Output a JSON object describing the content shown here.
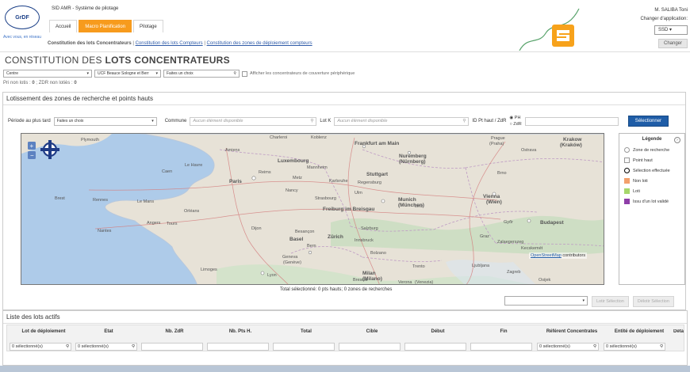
{
  "header": {
    "logo_text": "GrDF",
    "logo_tagline": "Avec vous, en réseau",
    "app_title": "SID AMR - Système de pilotage",
    "nav_tabs": [
      {
        "label": "Accueil",
        "active": false
      },
      {
        "label": "Macro Planification",
        "active": true
      },
      {
        "label": "Pilotage",
        "active": false
      }
    ],
    "subnav": {
      "current": "Constitution des lots Concentrateurs",
      "sep": "|",
      "links": [
        "Constitution des lots Compteurs",
        "Constitution des zones de déploiement compteurs"
      ]
    },
    "user_name": "M. SALIBA Toni",
    "change_app_label": "Changer d'application:",
    "app_value": "SSD",
    "change_button": "Changer"
  },
  "page_title_prefix": "CONSTITUTION DES",
  "page_title_bold": "LOTS CONCENTRATEURS",
  "filters": {
    "region": "Centre",
    "ucf": "UCF Beauce Sologne et Berr",
    "choice": "Faites un choix",
    "peripheral_label": "Afficher les concentrateurs de couverture périphérique"
  },
  "counts": {
    "pri_label": "Pri non lotis :",
    "pri_value": "0",
    "zdr_label": "; ZDR non lotiès :",
    "zdr_value": "0"
  },
  "lotissement": {
    "title": "Lotissement des zones de recherche et points hauts",
    "periode_label": "Période au plus tard",
    "periode_value": "Faites un choix",
    "commune_label": "Commune",
    "commune_placeholder": "Aucun élément disponible",
    "lotk_label": "Lot K",
    "lotk_placeholder": "Aucun élément disponible",
    "id_label": "ID Pt haut / ZdR",
    "radio_ph": "PH",
    "radio_zdr": "ZdR",
    "select_button": "Sélectionner"
  },
  "map": {
    "attribution_link": "OpenStreetMap",
    "attribution_rest": "contributors",
    "cities": [
      "Plymouth",
      "Amiens",
      "Le Havre",
      "Charleroi",
      "Koblenz",
      "Frankfurt am Main",
      "Prague (Praha)",
      "Krakow (Kraków)",
      "Luxembourg",
      "Nuremberg (Nürnberg)",
      "Ostrava",
      "Caen",
      "Reims",
      "Metz",
      "Mannheim",
      "Plzeň",
      "Brno",
      "Paris",
      "Nancy",
      "Karlsruhe",
      "Stuttgart",
      "Regensburg",
      "Rennes",
      "Le Mans",
      "Orléans",
      "Strasbourg",
      "Ulm",
      "Munich (München)",
      "Linz",
      "Vienna (Wien)",
      "Brest",
      "Angers",
      "Tours",
      "Freiburg im Breisgau",
      "Salzburg",
      "Győr",
      "Budapest",
      "Nantes",
      "Dijon",
      "Besançon",
      "Basel",
      "Zürich",
      "Innsbruck",
      "Graz",
      "Kecskemét",
      "Bern",
      "Bolzano",
      "Zalaegerszeg",
      "Geneva (Genève)",
      "Trento",
      "Ljubljana",
      "Zagreb",
      "Limoges",
      "Lyon",
      "Milan (Milano)",
      "Verona",
      "Venice (Venezia)",
      "Osijek",
      "Brescia"
    ]
  },
  "legend": {
    "title": "Légende",
    "items": [
      {
        "label": "Zone de recherche",
        "type": "zone"
      },
      {
        "label": "Point haut",
        "type": "tower"
      },
      {
        "label": "Sélection effectuée",
        "type": "ring"
      },
      {
        "label": "Non loti",
        "type": "swatch",
        "color": "#f3a06c"
      },
      {
        "label": "Loti",
        "type": "swatch",
        "color": "#a6d66b"
      },
      {
        "label": "Issu d'un lot validé",
        "type": "swatch",
        "color": "#8e3ea8"
      }
    ]
  },
  "total_text": "Total sélectionné: 0 pts hauts; 0 zones de recherches",
  "actions": {
    "lotir": "Lotir Sélection",
    "delotir": "Délotir Sélection"
  },
  "lots_panel_title": "Liste des lots actifs",
  "table": {
    "columns": [
      "Lot de déploiement",
      "Etat",
      "Nb. ZdR",
      "Nb. Pts H.",
      "Total",
      "Cible",
      "Début",
      "Fin",
      "Référent Concentrates",
      "Entité de déploiement",
      "Déta"
    ],
    "filter_text": "0 sélectionné(s)"
  },
  "colors": {
    "accent_orange": "#f79b1d",
    "primary_blue": "#1f5da7"
  }
}
